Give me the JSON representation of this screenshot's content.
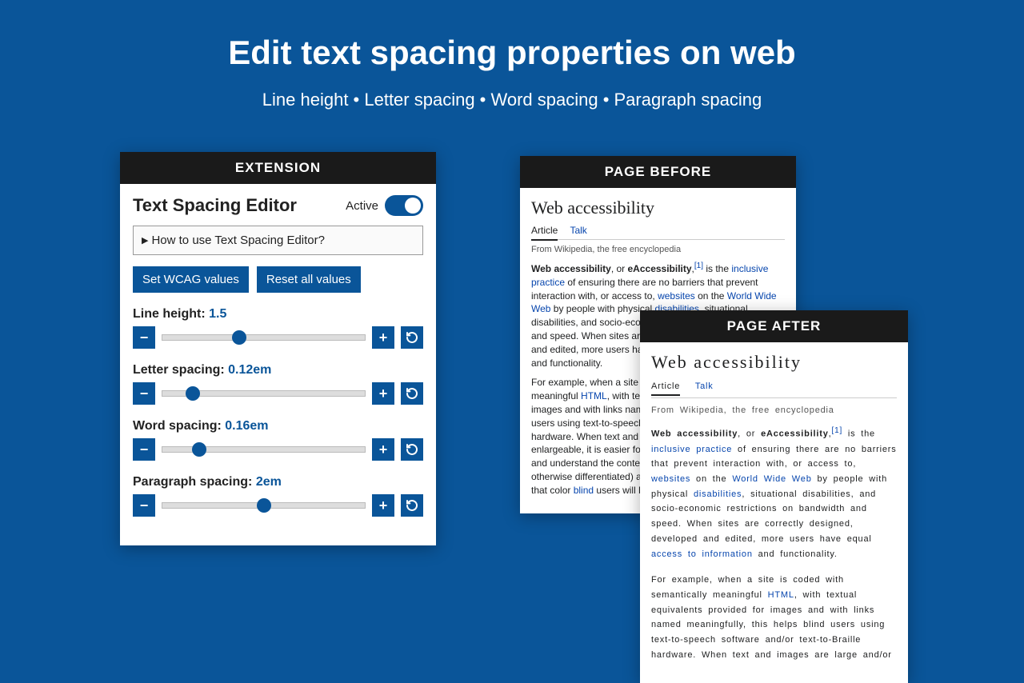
{
  "hero": {
    "title": "Edit text spacing properties on web",
    "subtitle": "Line height • Letter spacing • Word spacing • Paragraph spacing"
  },
  "extension": {
    "header": "EXTENSION",
    "title": "Text Spacing Editor",
    "active_label": "Active",
    "howto": "How to use Text Spacing Editor?",
    "set_wcag": "Set WCAG values",
    "reset_all": "Reset all values",
    "props": [
      {
        "label": "Line height:",
        "value": "1.5",
        "pos": 38
      },
      {
        "label": "Letter spacing:",
        "value": "0.12em",
        "pos": 15
      },
      {
        "label": "Word spacing:",
        "value": "0.16em",
        "pos": 18
      },
      {
        "label": "Paragraph spacing:",
        "value": "2em",
        "pos": 50
      }
    ]
  },
  "page_before": {
    "header": "PAGE BEFORE",
    "title": "Web accessibility",
    "tab_article": "Article",
    "tab_talk": "Talk",
    "source": "From Wikipedia, the free encyclopedia",
    "ref": "[1]"
  },
  "page_after": {
    "header": "PAGE AFTER",
    "title": "Web accessibility",
    "tab_article": "Article",
    "tab_talk": "Talk",
    "source": "From Wikipedia, the free encyclopedia",
    "ref": "[1]"
  }
}
